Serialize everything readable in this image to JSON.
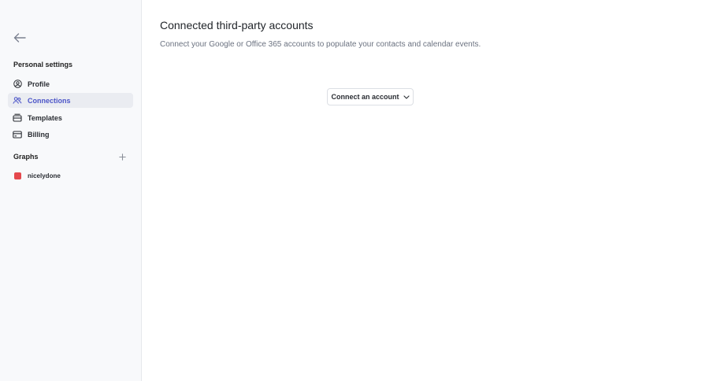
{
  "sidebar": {
    "personal_settings_title": "Personal settings",
    "items": [
      {
        "label": "Profile",
        "icon": "user-circle-icon"
      },
      {
        "label": "Connections",
        "icon": "users-icon",
        "active": true
      },
      {
        "label": "Templates",
        "icon": "template-icon"
      },
      {
        "label": "Billing",
        "icon": "credit-card-icon"
      }
    ],
    "graphs_title": "Graphs",
    "graphs": [
      {
        "label": "nicelydone",
        "color": "#e5484d"
      }
    ]
  },
  "main": {
    "title": "Connected third-party accounts",
    "description": "Connect your Google or Office 365 accounts to populate your contacts and calendar events.",
    "connect_button_label": "Connect an account"
  },
  "colors": {
    "accent": "#4c55c8",
    "active_bg": "#eaecf1",
    "sidebar_bg": "#f8f9fb"
  }
}
